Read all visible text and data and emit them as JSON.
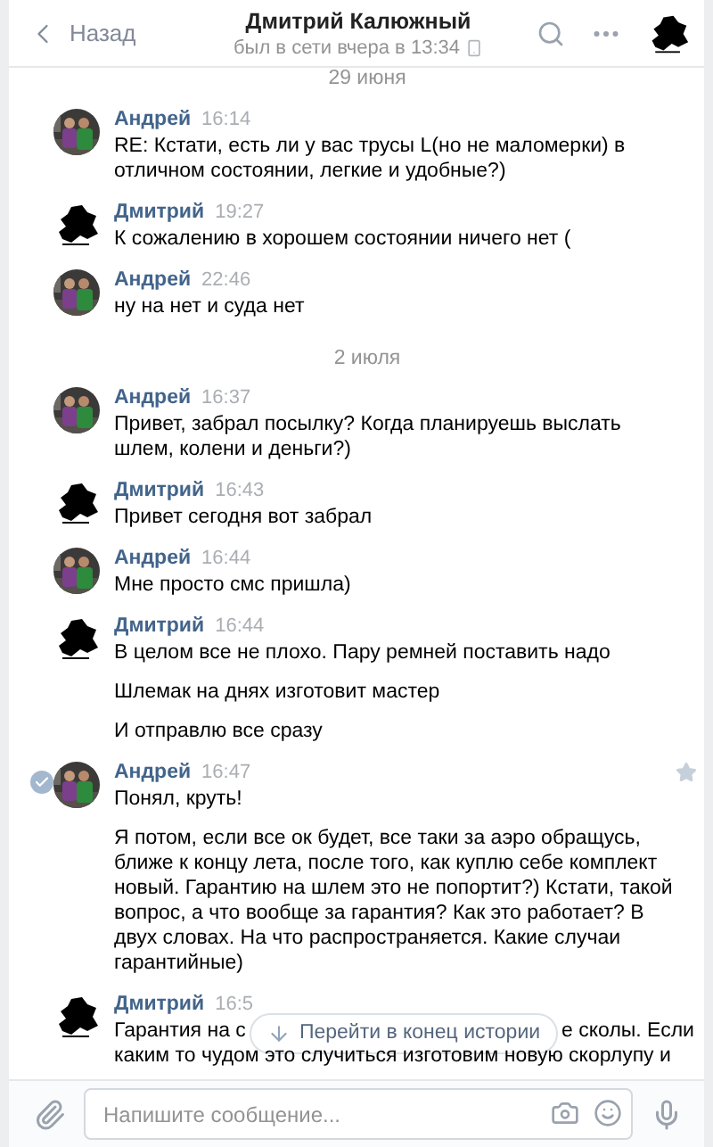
{
  "header": {
    "back_label": "Назад",
    "title": "Дмитрий Калюжный",
    "status": "был в сети вчера в 13:34"
  },
  "feed": [
    {
      "kind": "date",
      "label": "29 июня"
    },
    {
      "kind": "outgoing",
      "author": "Андрей",
      "time": "16:14",
      "selected": false,
      "paragraphs": [
        "RE: Кстати, есть ли у вас трусы L(но не маломерки) в отличном состоянии, легкие и удобные?)"
      ]
    },
    {
      "kind": "incoming",
      "author": "Дмитрий",
      "time": "19:27",
      "selected": false,
      "paragraphs": [
        "К сожалению в хорошем состоянии ничего нет ("
      ]
    },
    {
      "kind": "outgoing",
      "author": "Андрей",
      "time": "22:46",
      "selected": false,
      "paragraphs": [
        "ну на нет и суда нет"
      ]
    },
    {
      "kind": "date",
      "label": "2 июля"
    },
    {
      "kind": "outgoing",
      "author": "Андрей",
      "time": "16:37",
      "selected": false,
      "paragraphs": [
        "Привет, забрал посылку? Когда планируешь выслать шлем, колени и деньги?)"
      ]
    },
    {
      "kind": "incoming",
      "author": "Дмитрий",
      "time": "16:43",
      "selected": false,
      "paragraphs": [
        "Привет сегодня вот забрал"
      ]
    },
    {
      "kind": "outgoing",
      "author": "Андрей",
      "time": "16:44",
      "selected": false,
      "paragraphs": [
        "Мне просто смс пришла)"
      ]
    },
    {
      "kind": "incoming",
      "author": "Дмитрий",
      "time": "16:44",
      "selected": false,
      "paragraphs": [
        "В целом все не плохо. Пару ремней поставить надо",
        "Шлемак на днях изготовит мастер",
        "И отправлю все сразу"
      ]
    },
    {
      "kind": "outgoing",
      "author": "Андрей",
      "time": "16:47",
      "selected": true,
      "paragraphs": [
        "Понял, круть!",
        "Я потом, если все ок будет, все таки за аэро обращусь, ближе к концу лета, после того, как куплю себе комплект новый. Гарантию на шлем это не попортит?) Кстати, такой вопрос, а что вообще за гарантия? Как это работает? В двух словах. На что распространяется. Какие случаи гарантийные)"
      ]
    },
    {
      "kind": "incoming_covered",
      "author": "Дмитрий",
      "time": "16:5",
      "before": "Гарантия на с",
      "after": "е сколы. Если",
      "next_line": "каким то чудом это случиться изготовим новую скорлупу и"
    }
  ],
  "jump_button": "Перейти в конец истории",
  "composer": {
    "placeholder": "Напишите сообщение..."
  }
}
